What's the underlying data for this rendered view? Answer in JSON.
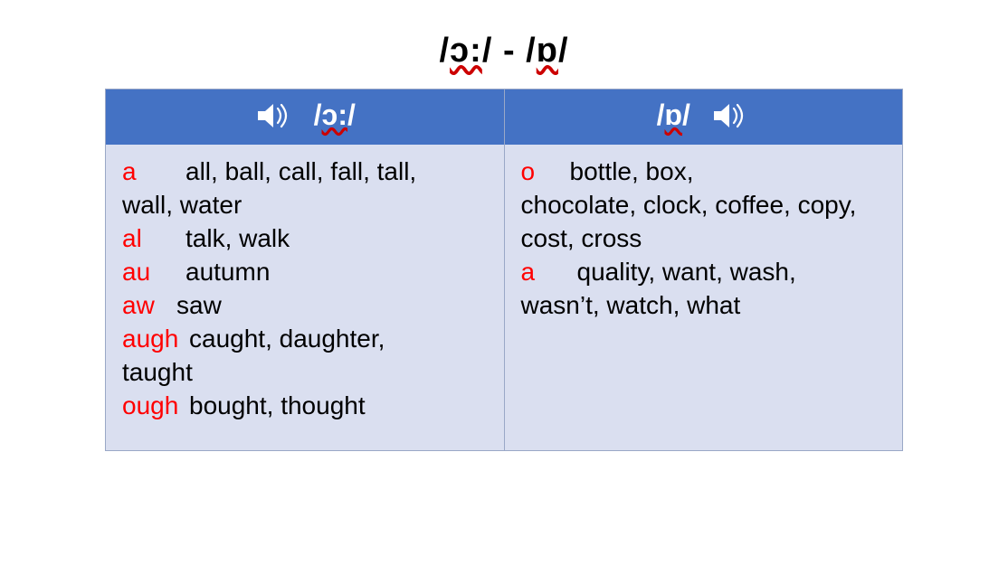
{
  "title": {
    "left_symbol": "ɔ:",
    "separator": " - ",
    "right_symbol": "ɒ"
  },
  "headers": {
    "left": "ɔ:",
    "right": "ɒ"
  },
  "icons": {
    "speaker": "speaker-icon"
  },
  "left_column": {
    "rows": [
      {
        "spell": "a",
        "cls": "s-a",
        "words_lead": "all, ball, call, fall, tall,",
        "words_wrap": "wall, water"
      },
      {
        "spell": "al",
        "cls": "s-al",
        "words_lead": "talk, walk",
        "words_wrap": ""
      },
      {
        "spell": "au",
        "cls": "s-au",
        "words_lead": "autumn",
        "words_wrap": ""
      },
      {
        "spell": "aw",
        "cls": "s-aw",
        "words_lead": "saw",
        "words_wrap": ""
      },
      {
        "spell": "augh",
        "cls": "s-augh",
        "words_lead": "caught, daughter,",
        "words_wrap": "taught"
      },
      {
        "spell": "ough",
        "cls": "s-ough",
        "words_lead": "bought, thought",
        "words_wrap": ""
      }
    ]
  },
  "right_column": {
    "rows": [
      {
        "spell": "o",
        "cls": "s-o",
        "words_lead": "bottle, box,",
        "words_wrap": "chocolate, clock, coffee, copy, cost, cross"
      },
      {
        "spell": "a",
        "cls": "s-a2",
        "words_lead": "quality, want, wash,",
        "words_wrap": "wasn’t, watch, what"
      }
    ]
  }
}
